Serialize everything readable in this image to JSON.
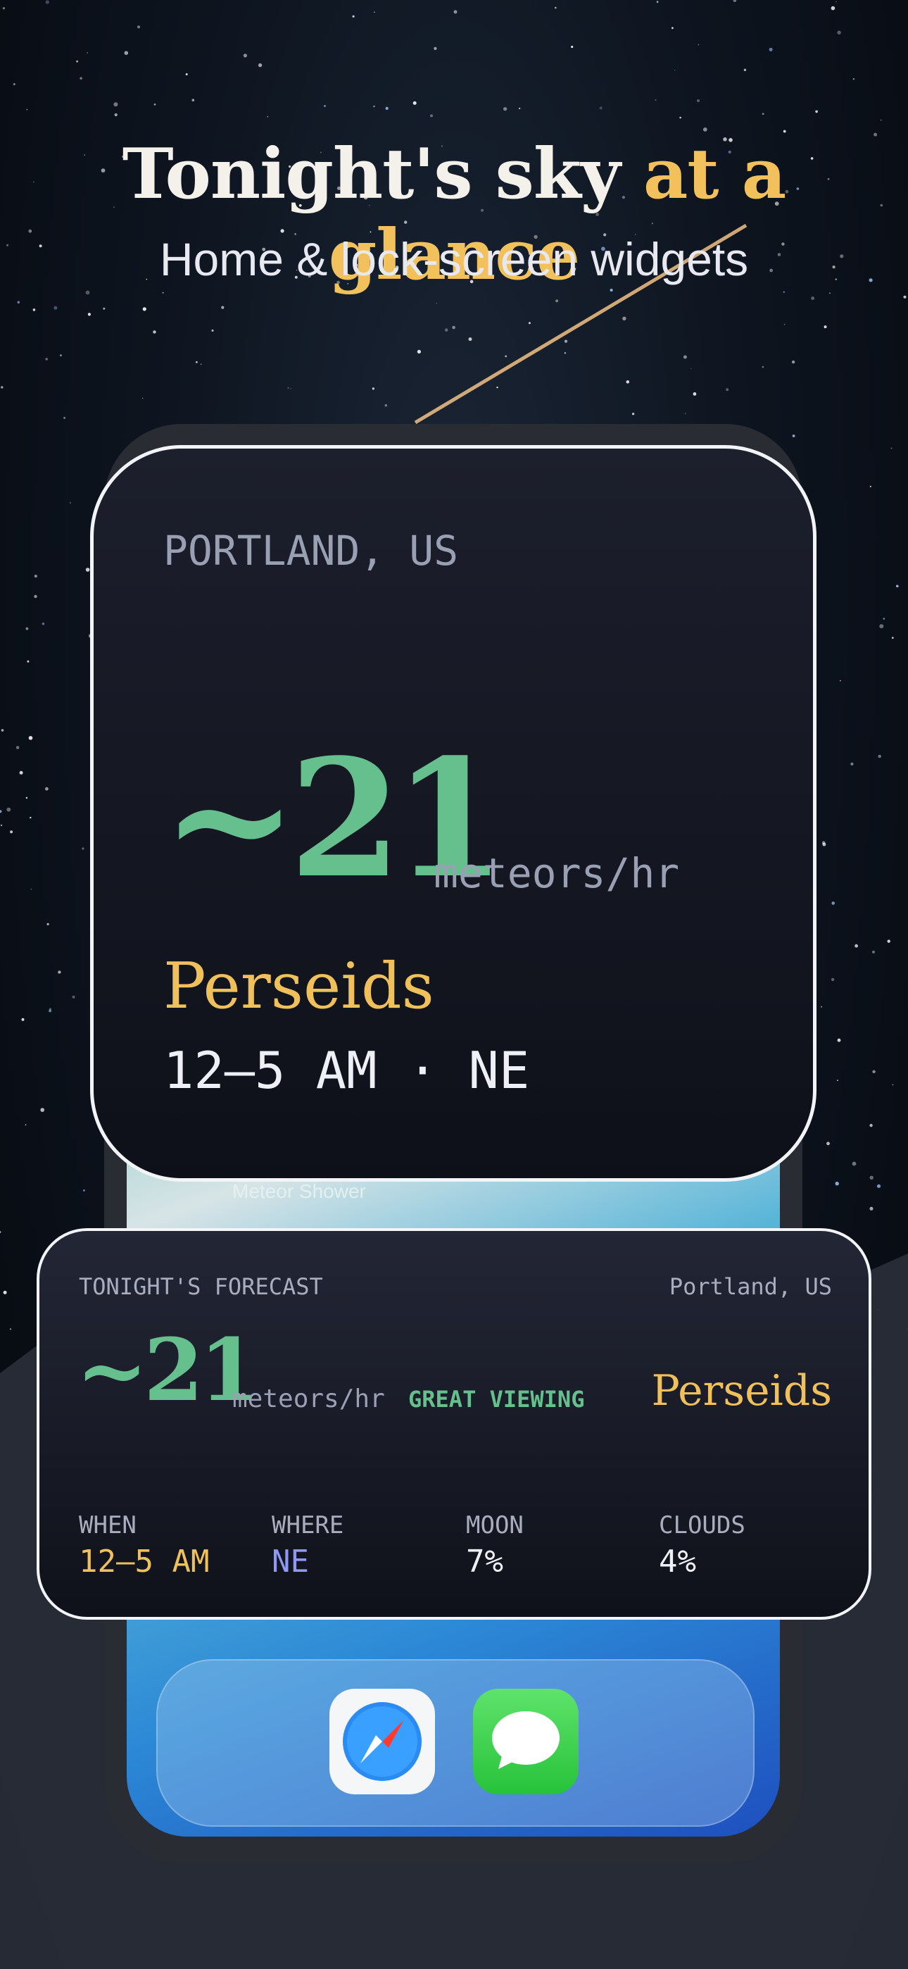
{
  "headline": {
    "title_main": "Tonight's sky",
    "title_accent": "at a glance",
    "subtitle": "Home & lock-screen widgets"
  },
  "phone": {
    "screen_label": "Meteor Shower",
    "dock_apps": [
      {
        "name": "Safari",
        "icon": "safari-compass-icon"
      },
      {
        "name": "Messages",
        "icon": "messages-bubble-icon"
      }
    ]
  },
  "large_widget": {
    "location": "PORTLAND, US",
    "rate": "~21",
    "unit": "meteors/hr",
    "shower": "Perseids",
    "time_direction": "12–5 AM · NE"
  },
  "medium_widget": {
    "title": "TONIGHT'S FORECAST",
    "location": "Portland, US",
    "rate": "~21",
    "unit": "meteors/hr",
    "quality": "GREAT VIEWING",
    "shower": "Perseids",
    "stats": [
      {
        "label": "WHEN",
        "value": "12–5 AM",
        "color": "#f0c15a"
      },
      {
        "label": "WHERE",
        "value": "NE",
        "color": "#8f98f2"
      },
      {
        "label": "MOON",
        "value": "7%",
        "color": "#eef0f5"
      },
      {
        "label": "CLOUDS",
        "value": "4%",
        "color": "#eef0f5"
      }
    ]
  },
  "colors": {
    "accent_gold": "#f2c15b",
    "accent_green": "#66c08d",
    "accent_purple": "#8f98f2"
  }
}
